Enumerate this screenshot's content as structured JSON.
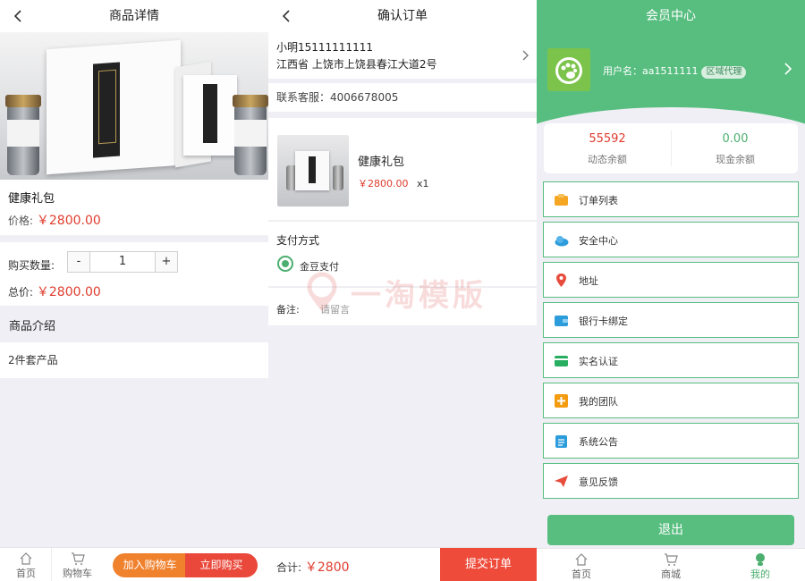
{
  "detail": {
    "title": "商品详情",
    "product_name": "健康礼包",
    "price_label": "价格:",
    "price": "￥2800.00",
    "qty_label": "购买数量:",
    "minus": "-",
    "qty": "1",
    "plus": "+",
    "total_label": "总价:",
    "total": "￥2800.00",
    "intro_title": "商品介绍",
    "intro_body": "2件套产品",
    "nav_home": "首页",
    "nav_cart": "购物车",
    "add_cart": "加入购物车",
    "buy_now": "立即购买"
  },
  "order": {
    "title": "确认订单",
    "contact": "小明15111111111",
    "address": "江西省 上饶市上饶县春江大道2号",
    "service": "联系客服：4006678005",
    "item_name": "健康礼包",
    "item_price": "￥2800.00",
    "item_qty": "x1",
    "pay_title": "支付方式",
    "pay_option": "金豆支付",
    "note_label": "备注:",
    "note_placeholder": "请留言",
    "total_label": "合计:",
    "total": "￥2800",
    "submit": "提交订单",
    "watermark": "一淘模版"
  },
  "member": {
    "title": "会员中心",
    "username": "用户名：aa1511111",
    "badge": "区域代理",
    "dynamic_balance": "55592",
    "dynamic_label": "动态余额",
    "cash_balance": "0.00",
    "cash_label": "现金余额",
    "menu": [
      {
        "label": "订单列表",
        "icon": "order-list-icon",
        "color": "#f5a623"
      },
      {
        "label": "安全中心",
        "icon": "cloud-security-icon",
        "color": "#2d9cdb"
      },
      {
        "label": "地址",
        "icon": "location-pin-icon",
        "color": "#e74c3c"
      },
      {
        "label": "银行卡绑定",
        "icon": "wallet-icon",
        "color": "#2d9cdb"
      },
      {
        "label": "实名认证",
        "icon": "id-card-icon",
        "color": "#27ae60"
      },
      {
        "label": "我的团队",
        "icon": "team-plus-icon",
        "color": "#f39c12"
      },
      {
        "label": "系统公告",
        "icon": "notice-clipboard-icon",
        "color": "#2d9cdb"
      },
      {
        "label": "意见反馈",
        "icon": "paper-plane-icon",
        "color": "#e74c3c"
      }
    ],
    "logout": "退出",
    "nav_home": "首页",
    "nav_mall": "商城",
    "nav_me": "我的"
  }
}
